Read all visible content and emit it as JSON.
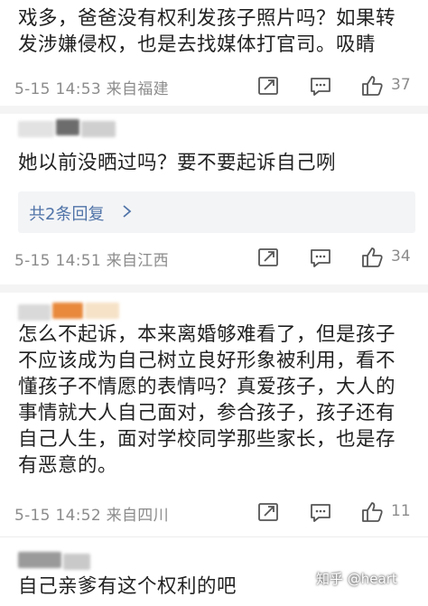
{
  "comments": [
    {
      "text": "戏多，爸爸没有权利发孩子照片吗？如果转\n发涉嫌侵权，也是去找媒体打官司。吸睛",
      "meta": "5-15 14:53  来自福建",
      "likes": "37"
    },
    {
      "text": "她以前没晒过吗？要不要起诉自己咧",
      "reply_link": "共2条回复",
      "meta": "5-15 14:51  来自江西",
      "likes": "34"
    },
    {
      "text": "怎么不起诉，本来离婚够难看了，但是孩子\n不应该成为自己树立良好形象被利用，看不\n懂孩子不情愿的表情吗？真爱孩子，大人的\n事情就大人自己面对，参合孩子，孩子还有\n自己人生，面对学校同学那些家长，也是存\n有恶意的。",
      "meta": "5-15 14:52  来自四川",
      "likes": "11"
    },
    {
      "text": "自己亲爹有这个权利的吧"
    }
  ],
  "watermark": "知乎 @heart",
  "colors": {
    "meta": "#8c8c8c",
    "link": "#5074a8",
    "reply_bg": "#f3f4f6"
  },
  "icons": [
    "share-icon",
    "comment-icon",
    "like-icon",
    "chevron-right-icon"
  ]
}
